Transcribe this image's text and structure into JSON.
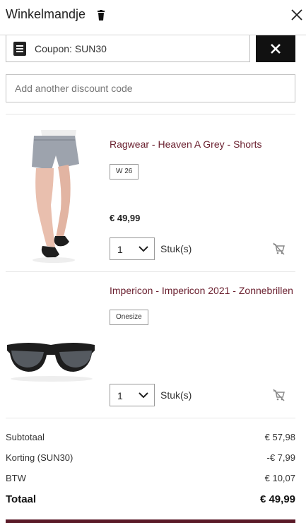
{
  "header": {
    "title": "Winkelmandje"
  },
  "coupon": {
    "label": "Coupon: SUN30"
  },
  "discount": {
    "placeholder": "Add another discount code"
  },
  "items": [
    {
      "name": "Ragwear - Heaven A Grey - Shorts",
      "size": "W 26",
      "price": "€ 49,99",
      "qty": "1",
      "unit": "Stuk(s)"
    },
    {
      "name": "Impericon - Impericon 2021 - Zonnebrillen",
      "size": "Onesize",
      "qty": "1",
      "unit": "Stuk(s)"
    }
  ],
  "summary": {
    "subtotal_label": "Subtotaal",
    "subtotal": "€ 57,98",
    "discount_label": "Korting (SUN30)",
    "discount": "-€ 7,99",
    "tax_label": "BTW",
    "tax": "€ 10,07",
    "total_label": "Totaal",
    "total": "€ 49,99"
  },
  "colors": {
    "accent": "#6b2130",
    "bar": "#5a1a28",
    "coupon_button": "#111111"
  }
}
